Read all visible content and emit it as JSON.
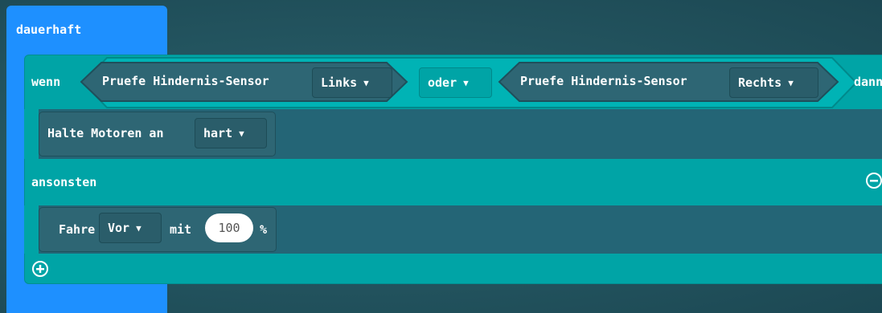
{
  "forever_label": "dauerhaft",
  "if_label": "wenn",
  "then_label": "dann",
  "else_label": "ansonsten",
  "cond_left": {
    "text": "Pruefe Hindernis-Sensor",
    "dropdown": "Links"
  },
  "operator": "oder",
  "cond_right": {
    "text": "Pruefe Hindernis-Sensor",
    "dropdown": "Rechts"
  },
  "stmt_then": {
    "text": "Halte Motoren an",
    "dropdown": "hart"
  },
  "stmt_else": {
    "text_before": "Fahre",
    "dropdown": "Vor",
    "text_mid": "mit",
    "value": "100",
    "text_after": "%"
  },
  "colors": {
    "forever": "#1e90ff",
    "logic": "#00a4a6",
    "inner": "#2e6674",
    "background": "#245661"
  },
  "icons": {
    "remove": "minus-circle-icon",
    "add": "plus-circle-icon",
    "dropdown": "triangle-down-icon"
  }
}
